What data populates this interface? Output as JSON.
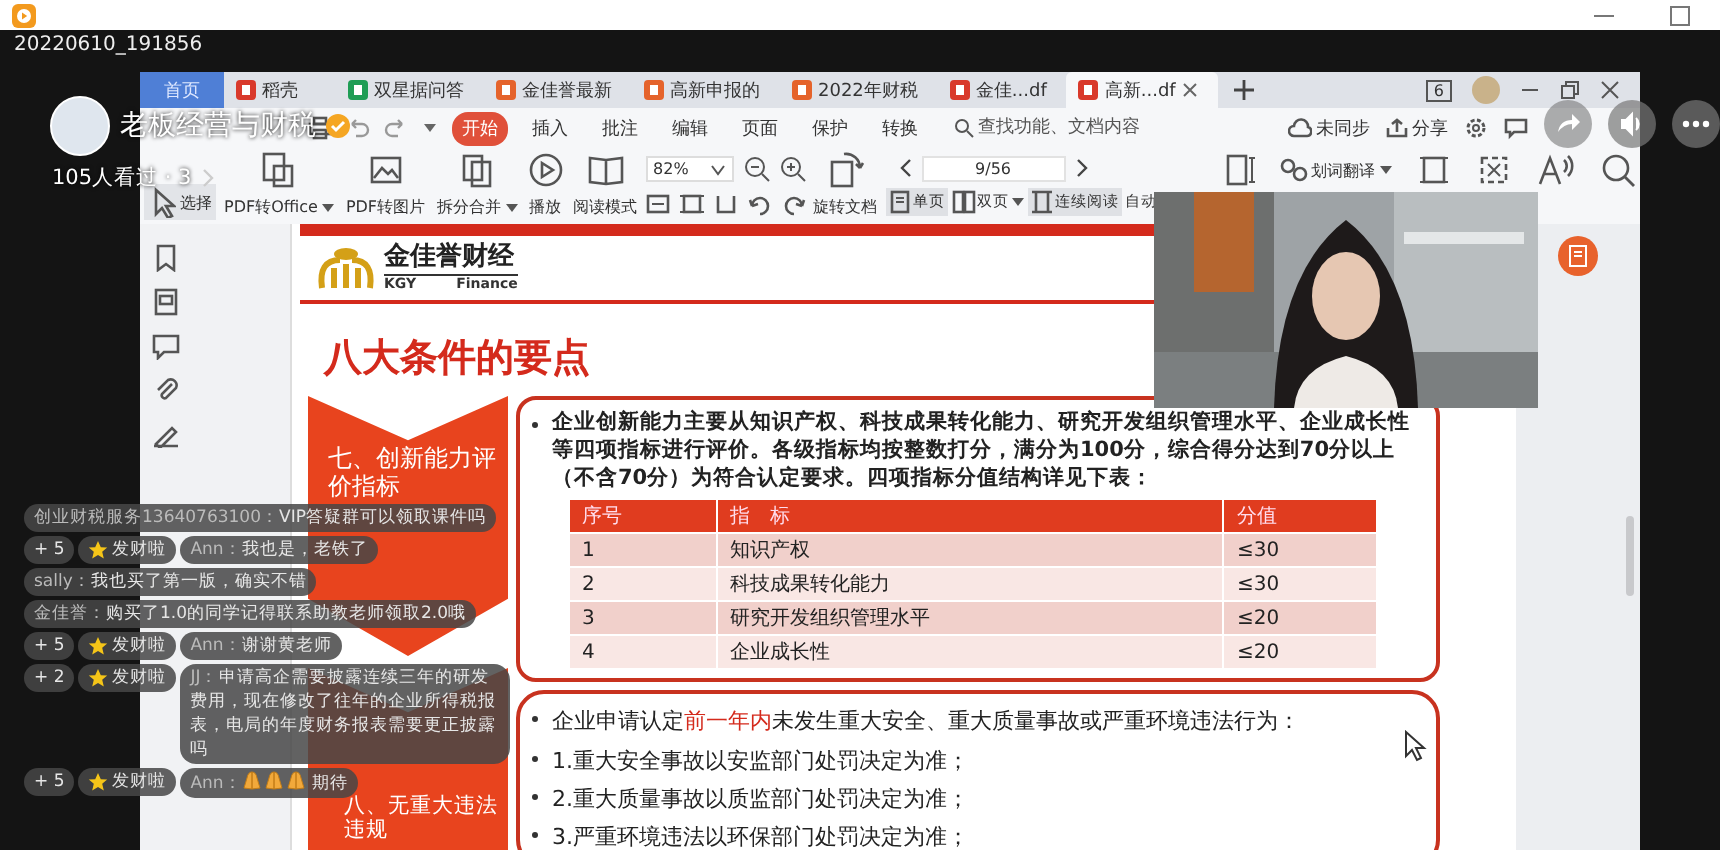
{
  "recording_title": "20220610_191856",
  "stream": {
    "title": "老板经营与财税",
    "views": "105人看过 · 3"
  },
  "app": {
    "tabs": [
      {
        "label": "首页",
        "kind": "home",
        "selected": false
      },
      {
        "label": "稻壳",
        "kind": "docer",
        "selected": false
      },
      {
        "label": "双星据问答",
        "kind": "sheet",
        "selected": false
      },
      {
        "label": "金佳誉最新",
        "kind": "slides",
        "selected": false
      },
      {
        "label": "高新申报的",
        "kind": "slides",
        "selected": false
      },
      {
        "label": "2022年财税",
        "kind": "slides",
        "selected": false
      },
      {
        "label": "金佳...df",
        "kind": "pdf",
        "selected": false
      },
      {
        "label": "高新...df",
        "kind": "pdf",
        "selected": true
      }
    ],
    "window_badge": "6",
    "menu": {
      "items": [
        {
          "label": "开始",
          "selected": true
        },
        {
          "label": "插入",
          "selected": false
        },
        {
          "label": "批注",
          "selected": false
        },
        {
          "label": "编辑",
          "selected": false
        },
        {
          "label": "页面",
          "selected": false
        },
        {
          "label": "保护",
          "selected": false
        },
        {
          "label": "转换",
          "selected": false
        }
      ],
      "search_placeholder": "查找功能、文档内容",
      "sync": "未同步",
      "share": "分享"
    },
    "tools": [
      {
        "label": "选择",
        "selected": true,
        "dropdown": false
      },
      {
        "label": "PDF转Office",
        "selected": false,
        "dropdown": true
      },
      {
        "label": "PDF转图片",
        "selected": false,
        "dropdown": false
      },
      {
        "label": "拆分合并",
        "selected": false,
        "dropdown": true
      },
      {
        "label": "播放",
        "selected": false,
        "dropdown": false
      },
      {
        "label": "阅读模式",
        "selected": false,
        "dropdown": false
      }
    ],
    "zoom": "82%",
    "rotate": "旋转文档",
    "page": "9/56",
    "view_modes": [
      {
        "label": "单页",
        "selected": true,
        "dropdown": false
      },
      {
        "label": "双页",
        "selected": false,
        "dropdown": true
      },
      {
        "label": "连续阅读",
        "selected": true,
        "dropdown": false
      }
    ],
    "auto": "自动",
    "translate": "划词翻译"
  },
  "slide": {
    "brand": "金佳誉财经",
    "brand_left": "KGY",
    "brand_right": "Finance",
    "title": "八大条件的要点",
    "sections": [
      {
        "label": "七、创新能力评价指标"
      },
      {
        "label": "八、无重大违法违规"
      }
    ],
    "intro": "企业创新能力主要从知识产权、科技成果转化能力、研究开发组织管理水平、企业成长性等四项指标进行评价。各级指标均按整数打分，满分为100分，综合得分达到70分以上（不含70分）为符合认定要求。四项指标分值结构详见下表：",
    "table": {
      "columns": [
        "序号",
        "指　标",
        "分值"
      ],
      "rows": [
        [
          "1",
          "知识产权",
          "≤30"
        ],
        [
          "2",
          "科技成果转化能力",
          "≤30"
        ],
        [
          "3",
          "研究开发组织管理水平",
          "≤20"
        ],
        [
          "4",
          "企业成长性",
          "≤20"
        ]
      ]
    },
    "lead": {
      "before": "企业申请认定",
      "highlight": "前一年内",
      "after": "未发生重大安全、重大质量事故或严重环境违法行为："
    },
    "bullets": [
      "1.重大安全事故以安监部门处罚决定为准；",
      "2.重大质量事故以质监部门处罚决定为准；",
      "3.严重环境违法以环保部门处罚决定为准；"
    ]
  },
  "chat": [
    {
      "kind": "plain",
      "user": "创业财税服务13640763100：",
      "text": "VIP答疑群可以领取课件吗"
    },
    {
      "kind": "gift",
      "count": "+ 5",
      "tag": "发财啦",
      "user": "Ann：",
      "text": "我也是，老铁了"
    },
    {
      "kind": "plain",
      "user": "sally：",
      "text": "我也买了第一版，确实不错"
    },
    {
      "kind": "plain",
      "user": "金佳誉：",
      "text": "购买了1.0的同学记得联系助教老师领取2.0哦"
    },
    {
      "kind": "gift",
      "count": "+ 5",
      "tag": "发财啦",
      "user": "Ann：",
      "text": "谢谢黄老师"
    },
    {
      "kind": "gift",
      "count": "+ 2",
      "tag": "发财啦",
      "user": "JJ：",
      "text": "申请高企需要披露连续三年的研发费用，现在修改了往年的企业所得税报表，电局的年度财务报表需要更正披露吗"
    },
    {
      "kind": "gift_pray",
      "count": "+ 5",
      "tag": "发财啦",
      "user": "Ann：",
      "text": "期待"
    }
  ]
}
